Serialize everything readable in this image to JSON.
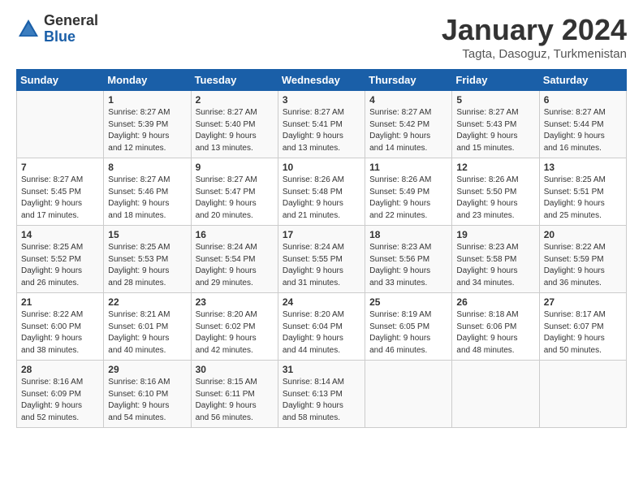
{
  "logo": {
    "general": "General",
    "blue": "Blue"
  },
  "header": {
    "month": "January 2024",
    "location": "Tagta, Dasoguz, Turkmenistan"
  },
  "weekdays": [
    "Sunday",
    "Monday",
    "Tuesday",
    "Wednesday",
    "Thursday",
    "Friday",
    "Saturday"
  ],
  "weeks": [
    [
      {
        "day": "",
        "sunrise": "",
        "sunset": "",
        "daylight": ""
      },
      {
        "day": "1",
        "sunrise": "Sunrise: 8:27 AM",
        "sunset": "Sunset: 5:39 PM",
        "daylight": "Daylight: 9 hours and 12 minutes."
      },
      {
        "day": "2",
        "sunrise": "Sunrise: 8:27 AM",
        "sunset": "Sunset: 5:40 PM",
        "daylight": "Daylight: 9 hours and 13 minutes."
      },
      {
        "day": "3",
        "sunrise": "Sunrise: 8:27 AM",
        "sunset": "Sunset: 5:41 PM",
        "daylight": "Daylight: 9 hours and 13 minutes."
      },
      {
        "day": "4",
        "sunrise": "Sunrise: 8:27 AM",
        "sunset": "Sunset: 5:42 PM",
        "daylight": "Daylight: 9 hours and 14 minutes."
      },
      {
        "day": "5",
        "sunrise": "Sunrise: 8:27 AM",
        "sunset": "Sunset: 5:43 PM",
        "daylight": "Daylight: 9 hours and 15 minutes."
      },
      {
        "day": "6",
        "sunrise": "Sunrise: 8:27 AM",
        "sunset": "Sunset: 5:44 PM",
        "daylight": "Daylight: 9 hours and 16 minutes."
      }
    ],
    [
      {
        "day": "7",
        "sunrise": "Sunrise: 8:27 AM",
        "sunset": "Sunset: 5:45 PM",
        "daylight": "Daylight: 9 hours and 17 minutes."
      },
      {
        "day": "8",
        "sunrise": "Sunrise: 8:27 AM",
        "sunset": "Sunset: 5:46 PM",
        "daylight": "Daylight: 9 hours and 18 minutes."
      },
      {
        "day": "9",
        "sunrise": "Sunrise: 8:27 AM",
        "sunset": "Sunset: 5:47 PM",
        "daylight": "Daylight: 9 hours and 20 minutes."
      },
      {
        "day": "10",
        "sunrise": "Sunrise: 8:26 AM",
        "sunset": "Sunset: 5:48 PM",
        "daylight": "Daylight: 9 hours and 21 minutes."
      },
      {
        "day": "11",
        "sunrise": "Sunrise: 8:26 AM",
        "sunset": "Sunset: 5:49 PM",
        "daylight": "Daylight: 9 hours and 22 minutes."
      },
      {
        "day": "12",
        "sunrise": "Sunrise: 8:26 AM",
        "sunset": "Sunset: 5:50 PM",
        "daylight": "Daylight: 9 hours and 23 minutes."
      },
      {
        "day": "13",
        "sunrise": "Sunrise: 8:25 AM",
        "sunset": "Sunset: 5:51 PM",
        "daylight": "Daylight: 9 hours and 25 minutes."
      }
    ],
    [
      {
        "day": "14",
        "sunrise": "Sunrise: 8:25 AM",
        "sunset": "Sunset: 5:52 PM",
        "daylight": "Daylight: 9 hours and 26 minutes."
      },
      {
        "day": "15",
        "sunrise": "Sunrise: 8:25 AM",
        "sunset": "Sunset: 5:53 PM",
        "daylight": "Daylight: 9 hours and 28 minutes."
      },
      {
        "day": "16",
        "sunrise": "Sunrise: 8:24 AM",
        "sunset": "Sunset: 5:54 PM",
        "daylight": "Daylight: 9 hours and 29 minutes."
      },
      {
        "day": "17",
        "sunrise": "Sunrise: 8:24 AM",
        "sunset": "Sunset: 5:55 PM",
        "daylight": "Daylight: 9 hours and 31 minutes."
      },
      {
        "day": "18",
        "sunrise": "Sunrise: 8:23 AM",
        "sunset": "Sunset: 5:56 PM",
        "daylight": "Daylight: 9 hours and 33 minutes."
      },
      {
        "day": "19",
        "sunrise": "Sunrise: 8:23 AM",
        "sunset": "Sunset: 5:58 PM",
        "daylight": "Daylight: 9 hours and 34 minutes."
      },
      {
        "day": "20",
        "sunrise": "Sunrise: 8:22 AM",
        "sunset": "Sunset: 5:59 PM",
        "daylight": "Daylight: 9 hours and 36 minutes."
      }
    ],
    [
      {
        "day": "21",
        "sunrise": "Sunrise: 8:22 AM",
        "sunset": "Sunset: 6:00 PM",
        "daylight": "Daylight: 9 hours and 38 minutes."
      },
      {
        "day": "22",
        "sunrise": "Sunrise: 8:21 AM",
        "sunset": "Sunset: 6:01 PM",
        "daylight": "Daylight: 9 hours and 40 minutes."
      },
      {
        "day": "23",
        "sunrise": "Sunrise: 8:20 AM",
        "sunset": "Sunset: 6:02 PM",
        "daylight": "Daylight: 9 hours and 42 minutes."
      },
      {
        "day": "24",
        "sunrise": "Sunrise: 8:20 AM",
        "sunset": "Sunset: 6:04 PM",
        "daylight": "Daylight: 9 hours and 44 minutes."
      },
      {
        "day": "25",
        "sunrise": "Sunrise: 8:19 AM",
        "sunset": "Sunset: 6:05 PM",
        "daylight": "Daylight: 9 hours and 46 minutes."
      },
      {
        "day": "26",
        "sunrise": "Sunrise: 8:18 AM",
        "sunset": "Sunset: 6:06 PM",
        "daylight": "Daylight: 9 hours and 48 minutes."
      },
      {
        "day": "27",
        "sunrise": "Sunrise: 8:17 AM",
        "sunset": "Sunset: 6:07 PM",
        "daylight": "Daylight: 9 hours and 50 minutes."
      }
    ],
    [
      {
        "day": "28",
        "sunrise": "Sunrise: 8:16 AM",
        "sunset": "Sunset: 6:09 PM",
        "daylight": "Daylight: 9 hours and 52 minutes."
      },
      {
        "day": "29",
        "sunrise": "Sunrise: 8:16 AM",
        "sunset": "Sunset: 6:10 PM",
        "daylight": "Daylight: 9 hours and 54 minutes."
      },
      {
        "day": "30",
        "sunrise": "Sunrise: 8:15 AM",
        "sunset": "Sunset: 6:11 PM",
        "daylight": "Daylight: 9 hours and 56 minutes."
      },
      {
        "day": "31",
        "sunrise": "Sunrise: 8:14 AM",
        "sunset": "Sunset: 6:13 PM",
        "daylight": "Daylight: 9 hours and 58 minutes."
      },
      {
        "day": "",
        "sunrise": "",
        "sunset": "",
        "daylight": ""
      },
      {
        "day": "",
        "sunrise": "",
        "sunset": "",
        "daylight": ""
      },
      {
        "day": "",
        "sunrise": "",
        "sunset": "",
        "daylight": ""
      }
    ]
  ]
}
